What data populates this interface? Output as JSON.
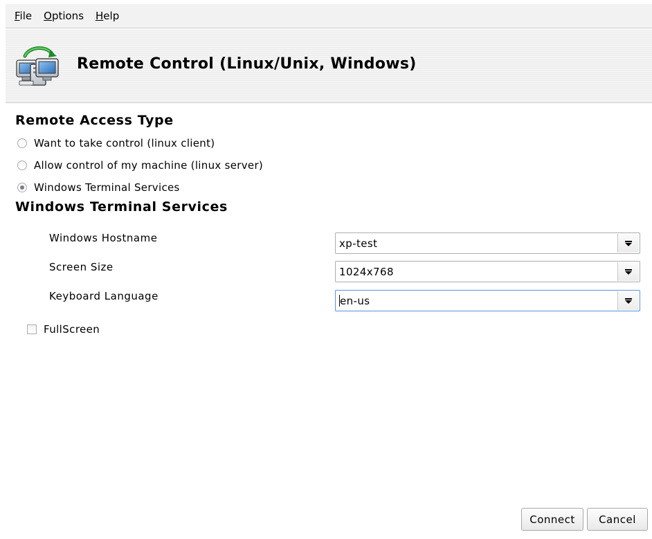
{
  "menubar": {
    "items": [
      {
        "mnemonic": "F",
        "rest": "ile"
      },
      {
        "mnemonic": "O",
        "rest": "ptions"
      },
      {
        "mnemonic": "H",
        "rest": "elp"
      }
    ]
  },
  "header": {
    "title": "Remote Control (Linux/Unix, Windows)",
    "icon": "remote-computer-icon"
  },
  "access_type": {
    "title": "Remote Access Type",
    "options": [
      {
        "label": "Want to take control (linux client)",
        "checked": false
      },
      {
        "label": "Allow control of my machine (linux server)",
        "checked": false
      },
      {
        "label": "Windows Terminal Services",
        "checked": true
      }
    ]
  },
  "terminal_services": {
    "title": "Windows Terminal Services",
    "fields": [
      {
        "label": "Windows Hostname",
        "value": "xp-test"
      },
      {
        "label": "Screen Size",
        "value": "1024x768"
      },
      {
        "label": "Keyboard Language",
        "value": "en-us"
      }
    ],
    "fullscreen": {
      "label": "FullScreen",
      "checked": false
    }
  },
  "buttons": {
    "connect": "Connect",
    "cancel": "Cancel"
  },
  "colors": {
    "focus_border": "#5a92d6",
    "banner_bg": "#f0f0f0",
    "menubar_bg": "#f2f2f2"
  }
}
